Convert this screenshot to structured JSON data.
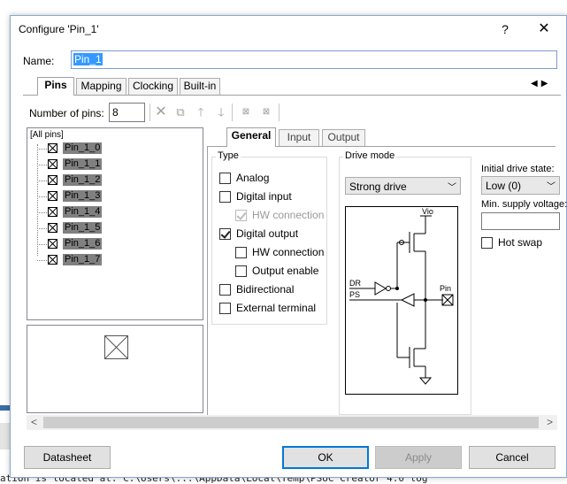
{
  "background": {
    "text_line": "ation is located at: C:\\Users\\...\\AppData\\Local\\Temp\\PSoC Creator 4.0 log"
  },
  "dialog": {
    "title": "Configure 'Pin_1'",
    "help_label": "?",
    "close_label": "✕"
  },
  "name": {
    "label": "Name:",
    "value": "Pin_1"
  },
  "tabs": [
    "Pins",
    "Mapping",
    "Clocking",
    "Built-in"
  ],
  "tab_scroll": {
    "left": "◀",
    "right": "▶"
  },
  "numpins": {
    "label": "Number of pins:",
    "value": "8"
  },
  "toolbar_icons": [
    "delete-icon",
    "swap-icon",
    "move-up-icon",
    "move-down-icon",
    "split-icon",
    "merge-icon"
  ],
  "tree": {
    "root": "[All pins]",
    "pins": [
      "Pin_1_0",
      "Pin_1_1",
      "Pin_1_2",
      "Pin_1_3",
      "Pin_1_4",
      "Pin_1_5",
      "Pin_1_6",
      "Pin_1_7"
    ]
  },
  "inner_tabs": [
    "General",
    "Input",
    "Output"
  ],
  "type": {
    "title": "Type",
    "options": [
      {
        "label": "Analog",
        "checked": false,
        "disabled": false
      },
      {
        "label": "Digital input",
        "checked": false,
        "disabled": false
      },
      {
        "label": "HW connection",
        "checked": true,
        "disabled": true
      },
      {
        "label": "Digital output",
        "checked": true,
        "disabled": false
      },
      {
        "label": "HW connection",
        "checked": false,
        "disabled": false
      },
      {
        "label": "Output enable",
        "checked": false,
        "disabled": false
      },
      {
        "label": "Bidirectional",
        "checked": false,
        "disabled": false
      },
      {
        "label": "External terminal",
        "checked": false,
        "disabled": false
      }
    ]
  },
  "drive": {
    "title": "Drive mode",
    "value": "Strong drive",
    "schematic": {
      "vio": "Vio",
      "dr": "DR",
      "ps": "PS",
      "pin": "Pin"
    }
  },
  "init_drive": {
    "label": "Initial drive state:",
    "value": "Low (0)"
  },
  "min_supply": {
    "label": "Min. supply voltage:",
    "value": ""
  },
  "hot_swap": {
    "label": "Hot swap",
    "checked": false
  },
  "buttons": {
    "datasheet": "Datasheet",
    "ok": "OK",
    "apply": "Apply",
    "cancel": "Cancel"
  },
  "scroll": {
    "left": "<",
    "right": ">"
  }
}
